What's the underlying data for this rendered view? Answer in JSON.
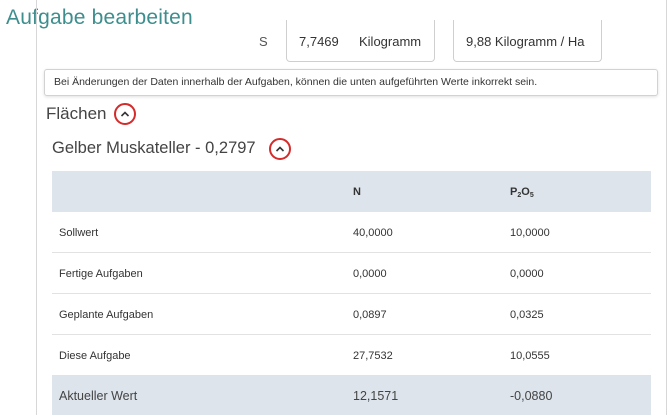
{
  "page": {
    "title": "Aufgabe bearbeiten"
  },
  "nutrient_row": {
    "label": "S",
    "amount_value": "7,7469",
    "amount_unit": "Kilogramm",
    "per_area": "9,88 Kilogramm / Ha"
  },
  "warning": "Bei Änderungen der Daten innerhalb der Aufgaben, können die unten aufgeführten Werte inkorrekt sein.",
  "areas": {
    "title": "Flächen",
    "field_title": "Gelber Muskateller - 0,2797"
  },
  "table": {
    "headers": {
      "label": "",
      "n": "N",
      "p_base": "P",
      "p_sub1": "2",
      "p_mid": "O",
      "p_sub2": "5"
    },
    "rows": [
      {
        "label": "Sollwert",
        "n": "40,0000",
        "p2o5": "10,0000"
      },
      {
        "label": "Fertige Aufgaben",
        "n": "0,0000",
        "p2o5": "0,0000"
      },
      {
        "label": "Geplante Aufgaben",
        "n": "0,0897",
        "p2o5": "0,0325"
      },
      {
        "label": "Diese Aufgabe",
        "n": "27,7532",
        "p2o5": "10,0555"
      },
      {
        "label": "Aktueller Wert",
        "n": "12,1571",
        "p2o5": "-0,0880"
      }
    ]
  },
  "colors": {
    "title": "#3e8e8e",
    "toggle_ring": "#d42b2b",
    "table_header_bg": "#dde4ec"
  },
  "icons": {
    "toggle": "chevron-up-icon"
  }
}
